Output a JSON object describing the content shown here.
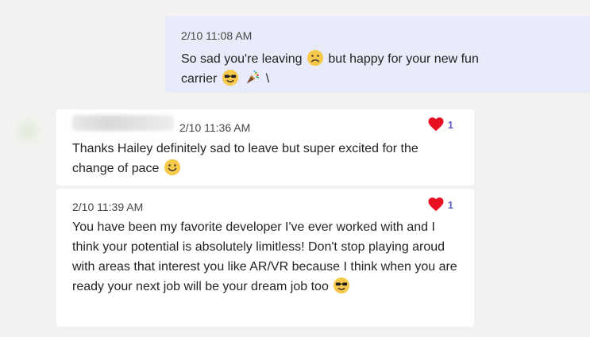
{
  "messages": {
    "sent": {
      "timestamp": "2/10 11:08 AM",
      "line_part_1": "So sad you're leaving",
      "line_part_2": "but happy for your new fun",
      "line_part_3": "carrier",
      "trailing_char": "\\"
    },
    "reply_1": {
      "timestamp": "2/10 11:36 AM",
      "text_part_1": "Thanks Hailey definitely sad to leave but super excited for the change of pace",
      "reaction_count": "1"
    },
    "reply_2": {
      "timestamp": "2/10 11:39 AM",
      "text_part_1": "You have been my favorite developer I've ever worked with and I think your potential is absolutely limitless! Don't stop playing aroud with areas that interest you like AR/VR because I think when you are ready your next job will be your dream job too",
      "reaction_count": "1"
    }
  },
  "icons": {
    "sad": "sad-face-icon",
    "cool": "sunglasses-face-icon",
    "party": "party-popper-icon",
    "smile": "smiling-face-icon",
    "heart": "heart-icon"
  },
  "colors": {
    "background": "#f3f2f1",
    "sent_bubble": "#e8ebfa",
    "received_bubble": "#ffffff",
    "heart": "#e81123",
    "reaction_count": "#5b5fc7"
  }
}
